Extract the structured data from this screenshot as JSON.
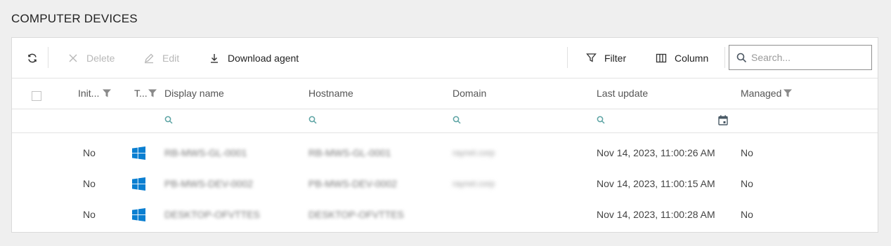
{
  "page_title": "COMPUTER DEVICES",
  "toolbar": {
    "delete_label": "Delete",
    "edit_label": "Edit",
    "download_label": "Download agent",
    "filter_label": "Filter",
    "column_label": "Column",
    "search_placeholder": "Search..."
  },
  "columns": {
    "init": "Init...",
    "type": "T...",
    "display_name": "Display name",
    "hostname": "Hostname",
    "domain": "Domain",
    "last_update": "Last update",
    "managed": "Managed"
  },
  "rows": [
    {
      "init": "No",
      "os_icon": "windows-icon",
      "display_name": "RB-MWS-GL-0001",
      "hostname": "RB-MWS-GL-0001",
      "domain": "raynet.corp",
      "last_update": "Nov 14, 2023, 11:00:26 AM",
      "managed": "No"
    },
    {
      "init": "No",
      "os_icon": "windows-icon",
      "display_name": "PB-MWS-DEV-0002",
      "hostname": "PB-MWS-DEV-0002",
      "domain": "raynet.corp",
      "last_update": "Nov 14, 2023, 11:00:15 AM",
      "managed": "No"
    },
    {
      "init": "No",
      "os_icon": "windows-icon",
      "display_name": "DESKTOP-OFVTTES",
      "hostname": "DESKTOP-OFVTTES",
      "domain": "",
      "last_update": "Nov 14, 2023, 11:00:28 AM",
      "managed": "No"
    }
  ],
  "colors": {
    "windows_blue": "#0a7fd1",
    "search_icon": "#5ba3a3",
    "calendar_icon": "#4a5a66"
  }
}
